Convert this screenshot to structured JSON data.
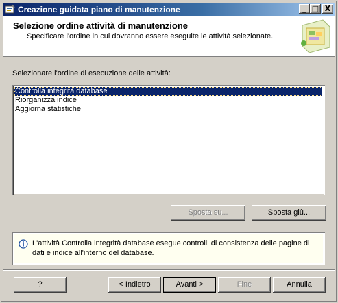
{
  "window": {
    "title": "Creazione guidata piano di manutenzione",
    "minimize_glyph": "_",
    "maximize_glyph": "□",
    "close_glyph": "X"
  },
  "header": {
    "title": "Selezione ordine attività di manutenzione",
    "subtitle": "Specificare l'ordine in cui dovranno essere eseguite le attività selezionate."
  },
  "task_list": {
    "label": "Selezionare l'ordine di esecuzione delle attività:",
    "items": [
      "Controlla integrità database",
      "Riorganizza indice",
      "Aggiorna statistiche"
    ],
    "selected_index": 0
  },
  "move_buttons": {
    "move_up": "Sposta su...",
    "move_down": "Sposta giù..."
  },
  "info": {
    "icon": "info-icon",
    "text": "L'attività Controlla integrità database esegue controlli di consistenza delle pagine di dati e indice all'interno del database."
  },
  "footer": {
    "help": "?",
    "back": "< Indietro",
    "next": "Avanti >",
    "finish": "Fine",
    "cancel": "Annulla"
  },
  "colors": {
    "selection": "#0a246a",
    "titlebar_start": "#0a246a",
    "titlebar_end": "#a6caf0",
    "face": "#d4d0c8",
    "info_background": "#fffff0"
  }
}
